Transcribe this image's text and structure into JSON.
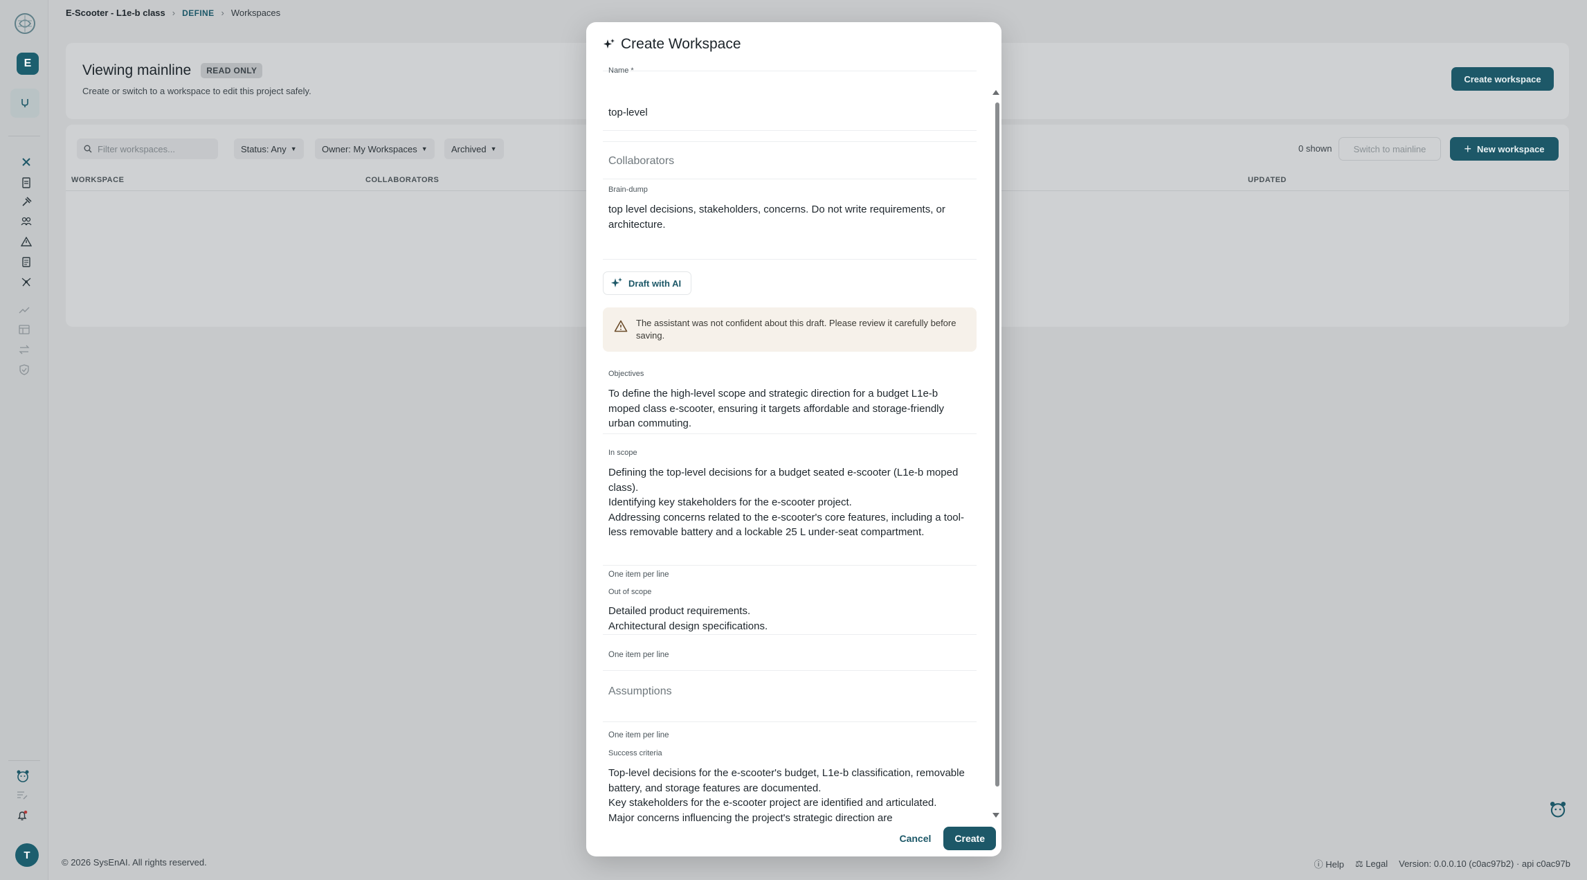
{
  "breadcrumb": {
    "project": "E-Scooter - L1e-b class",
    "section": "DEFINE",
    "page": "Workspaces"
  },
  "rail": {
    "workspace_initial": "E",
    "user_initial": "T"
  },
  "header_card": {
    "title": "Viewing mainline",
    "badge": "READ ONLY",
    "subtitle": "Create or switch to a workspace to edit this project safely.",
    "create_button": "Create workspace"
  },
  "list_card": {
    "filter_placeholder": "Filter workspaces...",
    "chips": [
      "Status: Any",
      "Owner: My Workspaces",
      "Archived"
    ],
    "shown_count": "0 shown",
    "switch_button": "Switch to mainline",
    "new_button": "New workspace",
    "columns": [
      "WORKSPACE",
      "COLLABORATORS",
      "UPDATED"
    ]
  },
  "footer": {
    "copyright": "© 2026 SysEnAI. All rights reserved.",
    "help": "Help",
    "legal": "Legal",
    "version": "Version: 0.0.0.10 (c0ac97b2) · api c0ac97b"
  },
  "modal": {
    "title": "Create Workspace",
    "name_label": "Name *",
    "name_value": "top-level",
    "collaborators_placeholder": "Collaborators",
    "braindump_label": "Brain-dump",
    "braindump_value": "top level decisions, stakeholders, concerns. Do not write requirements, or architecture.",
    "draft_button": "Draft with AI",
    "warning": "The assistant was not confident about this draft. Please review it carefully before saving.",
    "objectives_label": "Objectives",
    "objectives_value": "To define the high-level scope and strategic direction for a budget L1e-b moped class e-scooter, ensuring it targets affordable and storage-friendly urban commuting.",
    "in_scope_label": "In scope",
    "in_scope_lines": [
      "Defining the top-level decisions for a budget seated e-scooter (L1e-b moped class).",
      "Identifying key stakeholders for the e-scooter project.",
      "Addressing concerns related to the e-scooter's core features, including a tool-less removable battery and a lockable 25 L under-seat compartment."
    ],
    "hint": "One item per line",
    "out_of_scope_label": "Out of scope",
    "out_of_scope_lines": [
      "Detailed product requirements.",
      "Architectural design specifications."
    ],
    "assumptions_placeholder": "Assumptions",
    "success_label": "Success criteria",
    "success_lines": [
      "Top-level decisions for the e-scooter's budget, L1e-b classification, removable battery, and storage features are documented.",
      "Key stakeholders for the e-scooter project are identified and articulated.",
      "Major concerns influencing the project's strategic direction are"
    ],
    "cancel": "Cancel",
    "create": "Create"
  },
  "colors": {
    "accent": "#1d5868",
    "warning_bg": "#f6f1ea"
  }
}
